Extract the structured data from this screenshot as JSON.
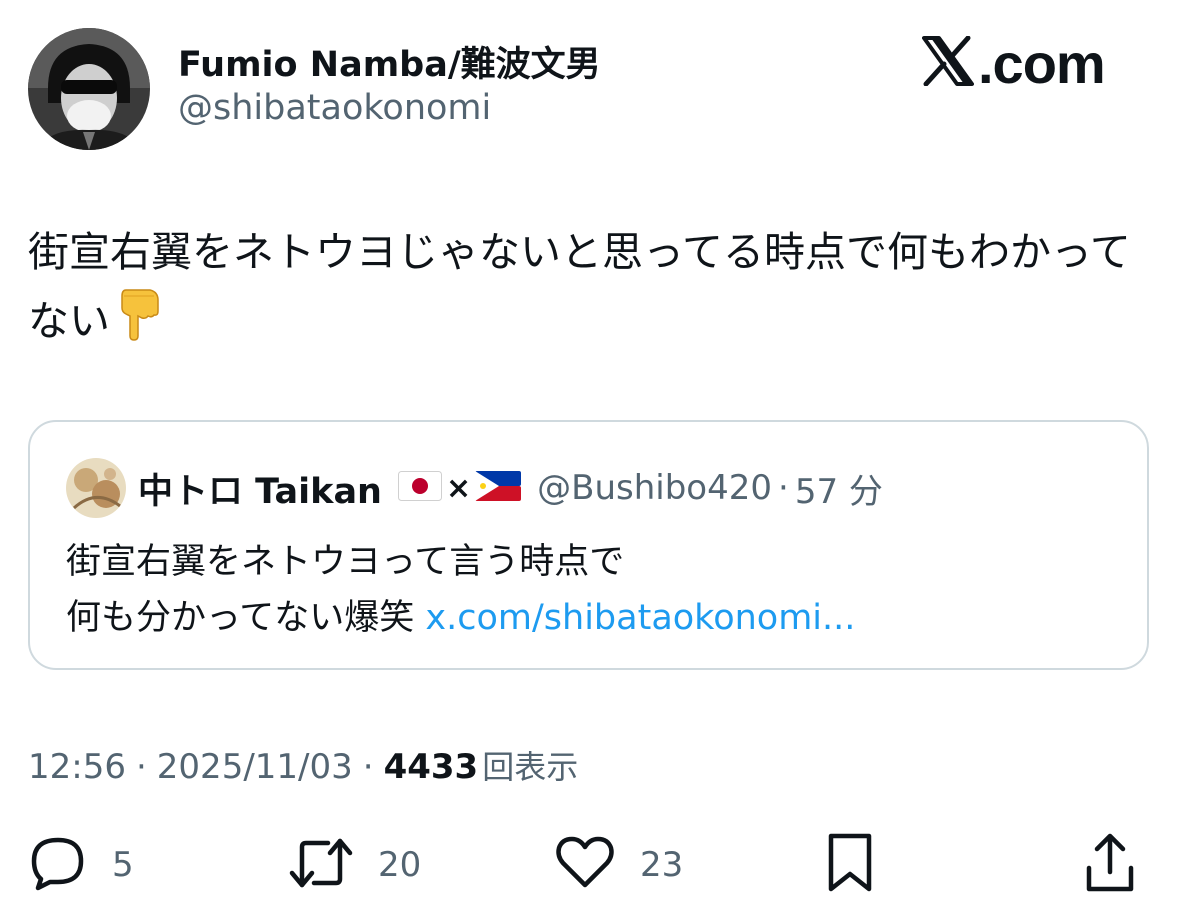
{
  "author": {
    "name": "Fumio Namba/難波文男",
    "handle": "@shibataokonomi"
  },
  "brand": {
    "text": ".com",
    "logo_icon": "x-logo-icon"
  },
  "tweet": {
    "text": "街宣右翼をネトウヨじゃないと思ってる時点で何もわかってない",
    "emoji": "👇"
  },
  "quote": {
    "name": "中トロ Taikan",
    "flag_left": "japan-flag",
    "times_symbol": "×",
    "flag_right": "philippines-flag",
    "handle": "@Bushibo420",
    "separator": "·",
    "time": "57 分",
    "text_line1": "街宣右翼をネトウヨって言う時点で",
    "text_line2": "何も分かってない爆笑",
    "link": "x.com/shibataokonomi..."
  },
  "meta": {
    "time": "12:56",
    "sep": "·",
    "date": "2025/11/03",
    "views_count": "4433",
    "views_label": "回表示"
  },
  "actions": {
    "replies": "5",
    "reposts": "20",
    "likes": "23"
  },
  "colors": {
    "text": "#0f1419",
    "secondary": "#536471",
    "link": "#1d9bf0",
    "border": "#cfd9de"
  }
}
